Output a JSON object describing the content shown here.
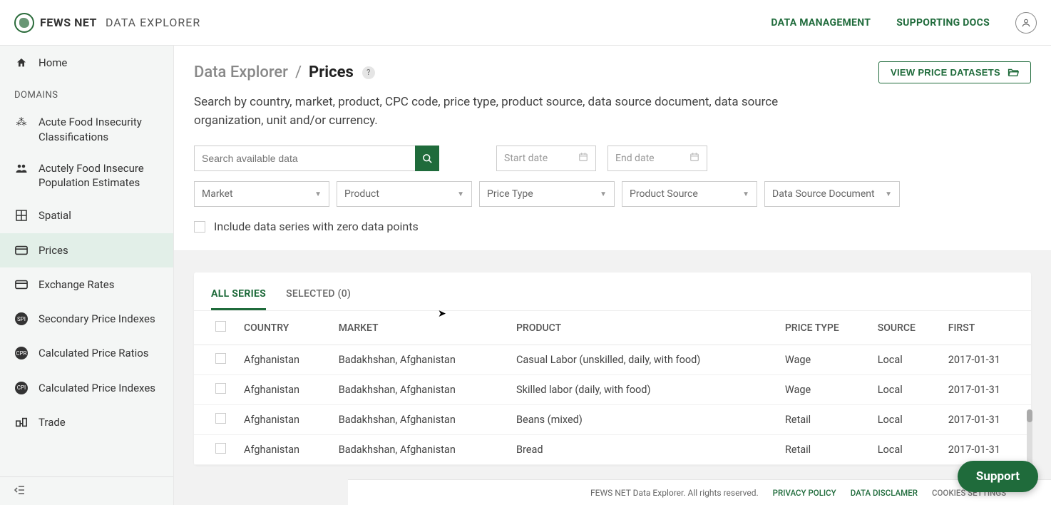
{
  "header": {
    "brand": "FEWS NET",
    "brand_sub": "DATA EXPLORER",
    "links": {
      "data_management": "DATA MANAGEMENT",
      "supporting_docs": "SUPPORTING DOCS"
    }
  },
  "sidebar": {
    "home": "Home",
    "section": "DOMAINS",
    "items": [
      {
        "label": "Acute Food Insecurity Classifications"
      },
      {
        "label": "Acutely Food Insecure Population Estimates"
      },
      {
        "label": "Spatial"
      },
      {
        "label": "Prices"
      },
      {
        "label": "Exchange Rates"
      },
      {
        "label": "Secondary Price Indexes"
      },
      {
        "label": "Calculated Price Ratios"
      },
      {
        "label": "Calculated Price Indexes"
      },
      {
        "label": "Trade"
      }
    ]
  },
  "breadcrumb": {
    "root": "Data Explorer",
    "sep": "/",
    "page": "Prices",
    "help": "?"
  },
  "view_btn": "VIEW PRICE DATASETS",
  "description": "Search by country, market, product, CPC code, price type, product source, data source document, data source organization, unit and/or currency.",
  "search": {
    "placeholder": "Search available data"
  },
  "dates": {
    "start": "Start date",
    "end": "End date"
  },
  "selects": {
    "market": "Market",
    "product": "Product",
    "price_type": "Price Type",
    "product_source": "Product Source",
    "data_source_doc": "Data Source Document"
  },
  "include_zero": "Include data series with zero data points",
  "tabs": {
    "all": "ALL SERIES",
    "selected": "SELECTED (0)"
  },
  "table": {
    "headers": {
      "country": "COUNTRY",
      "market": "MARKET",
      "product": "PRODUCT",
      "price_type": "PRICE TYPE",
      "source": "SOURCE",
      "first": "FIRST"
    },
    "rows": [
      {
        "country": "Afghanistan",
        "market": "Badakhshan, Afghanistan",
        "product": "Casual Labor (unskilled, daily, with food)",
        "price_type": "Wage",
        "source": "Local",
        "first": "2017-01-31"
      },
      {
        "country": "Afghanistan",
        "market": "Badakhshan, Afghanistan",
        "product": "Skilled labor (daily, with food)",
        "price_type": "Wage",
        "source": "Local",
        "first": "2017-01-31"
      },
      {
        "country": "Afghanistan",
        "market": "Badakhshan, Afghanistan",
        "product": "Beans (mixed)",
        "price_type": "Retail",
        "source": "Local",
        "first": "2017-01-31"
      },
      {
        "country": "Afghanistan",
        "market": "Badakhshan, Afghanistan",
        "product": "Bread",
        "price_type": "Retail",
        "source": "Local",
        "first": "2017-01-31"
      }
    ]
  },
  "footer": {
    "copy": "FEWS NET Data Explorer. All rights reserved.",
    "privacy": "PRIVACY POLICY",
    "disclaimer": "DATA DISCLAMER",
    "cookies": "COOKIES SETTINGS"
  },
  "support": "Support"
}
